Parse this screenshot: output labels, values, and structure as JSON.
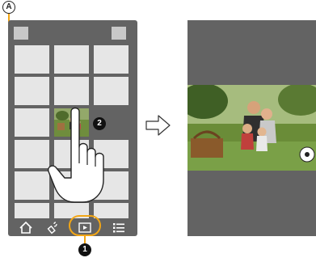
{
  "callouts": {
    "a_label": "A",
    "one_label": "1",
    "two_label": "2"
  },
  "icons": [
    "home-icon",
    "wifi-remote-icon",
    "playback-icon",
    "menu-list-icon"
  ],
  "colors": {
    "screen": "#636363",
    "thumbnail": "#e6e6e6",
    "highlight": "#f2a616"
  }
}
